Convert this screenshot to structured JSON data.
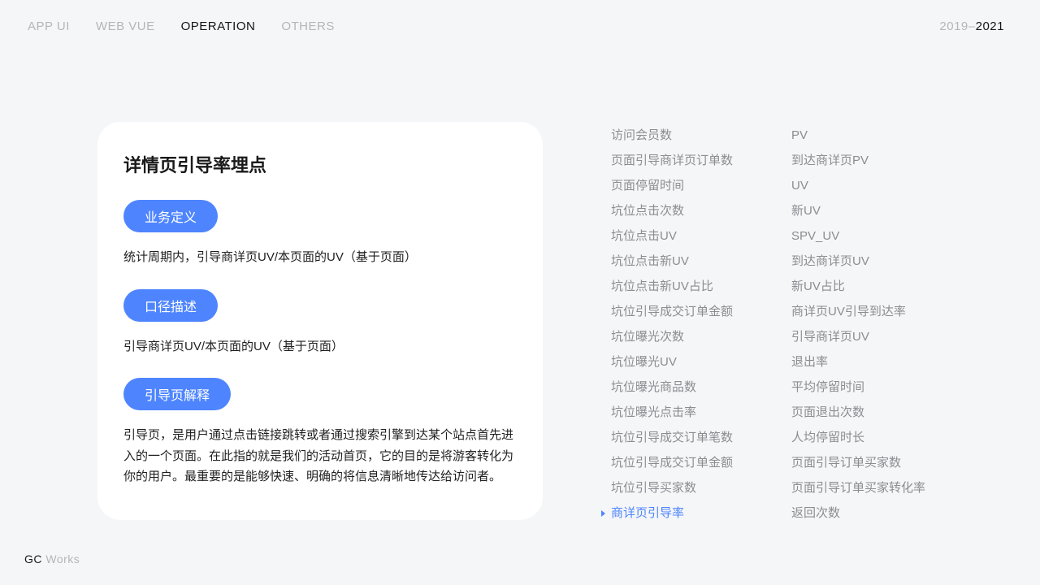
{
  "nav": {
    "items": [
      "APP UI",
      "WEB VUE",
      "OPERATION",
      "OTHERS"
    ],
    "activeIndex": 2
  },
  "year": {
    "range": "2019–",
    "current": "2021"
  },
  "card": {
    "title": "详情页引导率埋点",
    "sections": [
      {
        "pill": "业务定义",
        "text": "统计周期内，引导商详页UV/本页面的UV（基于页面）"
      },
      {
        "pill": "口径描述",
        "text": "引导商详页UV/本页面的UV（基于页面）"
      },
      {
        "pill": "引导页解释",
        "text": "引导页，是用户通过点击链接跳转或者通过搜索引擎到达某个站点首先进入的一个页面。在此指的就是我们的活动首页，它的目的是将游客转化为你的用户。最重要的是能够快速、明确的将信息清晰地传达给访问者。"
      }
    ]
  },
  "metrics": {
    "col1": [
      "访问会员数",
      "页面引导商详页订单数",
      "页面停留时间",
      "坑位点击次数",
      "坑位点击UV",
      "坑位点击新UV",
      "坑位点击新UV占比",
      "坑位引导成交订单金额",
      "坑位曝光次数",
      "坑位曝光UV",
      "坑位曝光商品数",
      "坑位曝光点击率",
      "坑位引导成交订单笔数",
      "坑位引导成交订单金额",
      "坑位引导买家数",
      "商详页引导率"
    ],
    "col1ActiveIndex": 15,
    "col2": [
      "PV",
      "到达商详页PV",
      "UV",
      "新UV",
      "SPV_UV",
      "到达商详页UV",
      "新UV占比",
      "商详页UV引导到达率",
      "引导商详页UV",
      "退出率",
      "平均停留时间",
      "页面退出次数",
      "人均停留时长",
      "页面引导订单买家数",
      "页面引导订单买家转化率",
      "返回次数"
    ]
  },
  "footer": {
    "strong": "GC",
    "weak": " Works"
  }
}
